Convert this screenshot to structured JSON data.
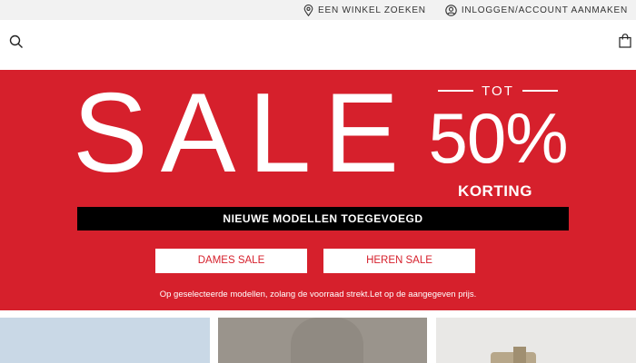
{
  "utility": {
    "store_finder_label": "EEN WINKEL ZOEKEN",
    "account_label": "INLOGGEN/ACCOUNT AANMAKEN"
  },
  "header": {
    "search_icon": "search-icon",
    "bag_icon": "shopping-bag-icon"
  },
  "hero": {
    "sale_word": "SALE",
    "tot": "TOT",
    "percent": "50%",
    "korting": "KORTING",
    "new_models_banner": "NIEUWE MODELLEN TOEGEVOEGD",
    "dames_button": "DAMES SALE",
    "heren_button": "HEREN SALE",
    "disclaimer": "Op geselecteerde modellen, zolang de voorraad strekt.Let op de aangegeven prijs."
  },
  "colors": {
    "brand_red": "#d6202c",
    "utility_bg": "#f2f2f2",
    "banner_black": "#000000"
  }
}
